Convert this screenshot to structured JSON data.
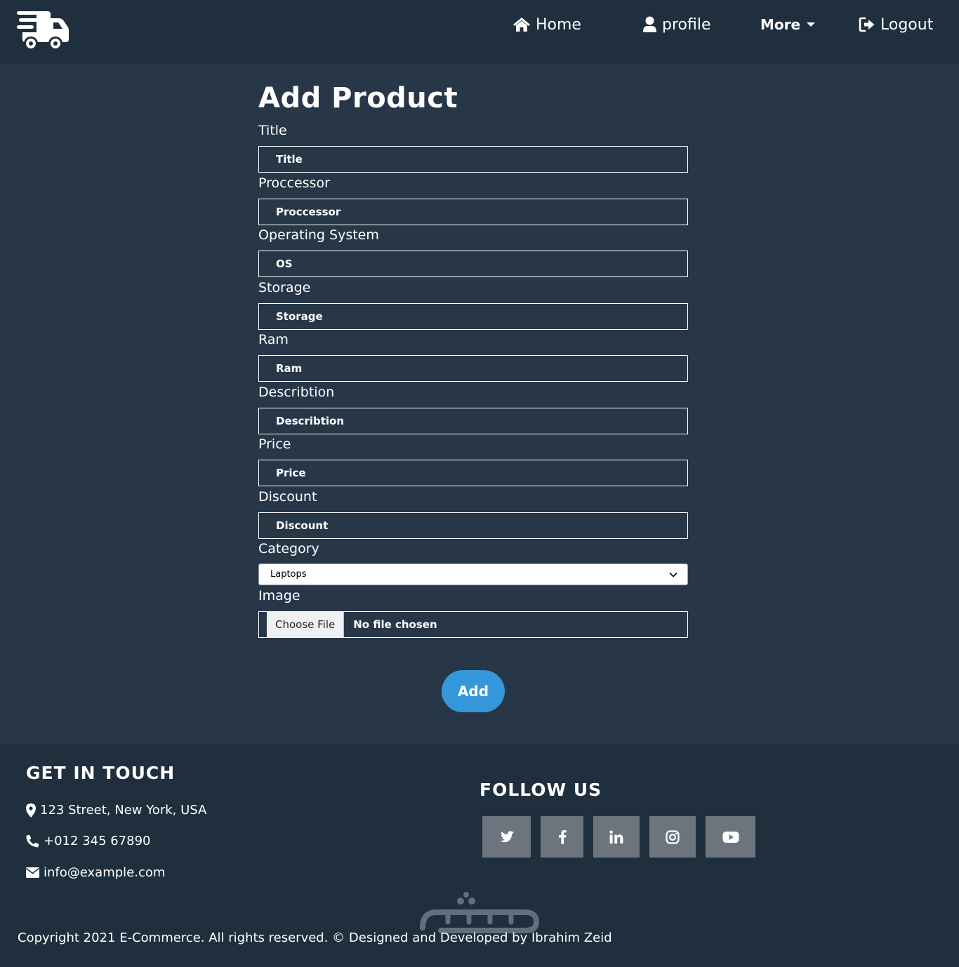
{
  "nav": {
    "home": "Home",
    "profile": "profile",
    "more": "More",
    "logout": "Logout"
  },
  "form": {
    "title": "Add Product",
    "fields": [
      {
        "label": "Title",
        "placeholder": "Title"
      },
      {
        "label": "Proccessor",
        "placeholder": "Proccessor"
      },
      {
        "label": "Operating System",
        "placeholder": "OS"
      },
      {
        "label": "Storage",
        "placeholder": "Storage"
      },
      {
        "label": "Ram",
        "placeholder": "Ram"
      },
      {
        "label": "Describtion",
        "placeholder": "Describtion"
      },
      {
        "label": "Price",
        "placeholder": "Price"
      },
      {
        "label": "Discount",
        "placeholder": "Discount"
      }
    ],
    "category": {
      "label": "Category",
      "selected": "Laptops"
    },
    "image": {
      "label": "Image",
      "button": "Choose File",
      "status": "No file chosen"
    },
    "submit": "Add"
  },
  "footer": {
    "touch_heading": "GET IN TOUCH",
    "address": "123 Street, New York, USA",
    "phone": "+012 345 67890",
    "email": "info@example.com",
    "follow_heading": "FOLLOW US",
    "socials": [
      "twitter-icon",
      "facebook-icon",
      "linkedin-icon",
      "instagram-icon",
      "youtube-icon"
    ],
    "copyright": "Copyright 2021 E-Commerce. All rights reserved. © Designed and Developed by Ibrahim Zeid"
  },
  "colors": {
    "navbar_bg": "#1f2f3e",
    "page_bg": "#283748",
    "accent": "#3498db",
    "social_bg": "#6c757d"
  }
}
